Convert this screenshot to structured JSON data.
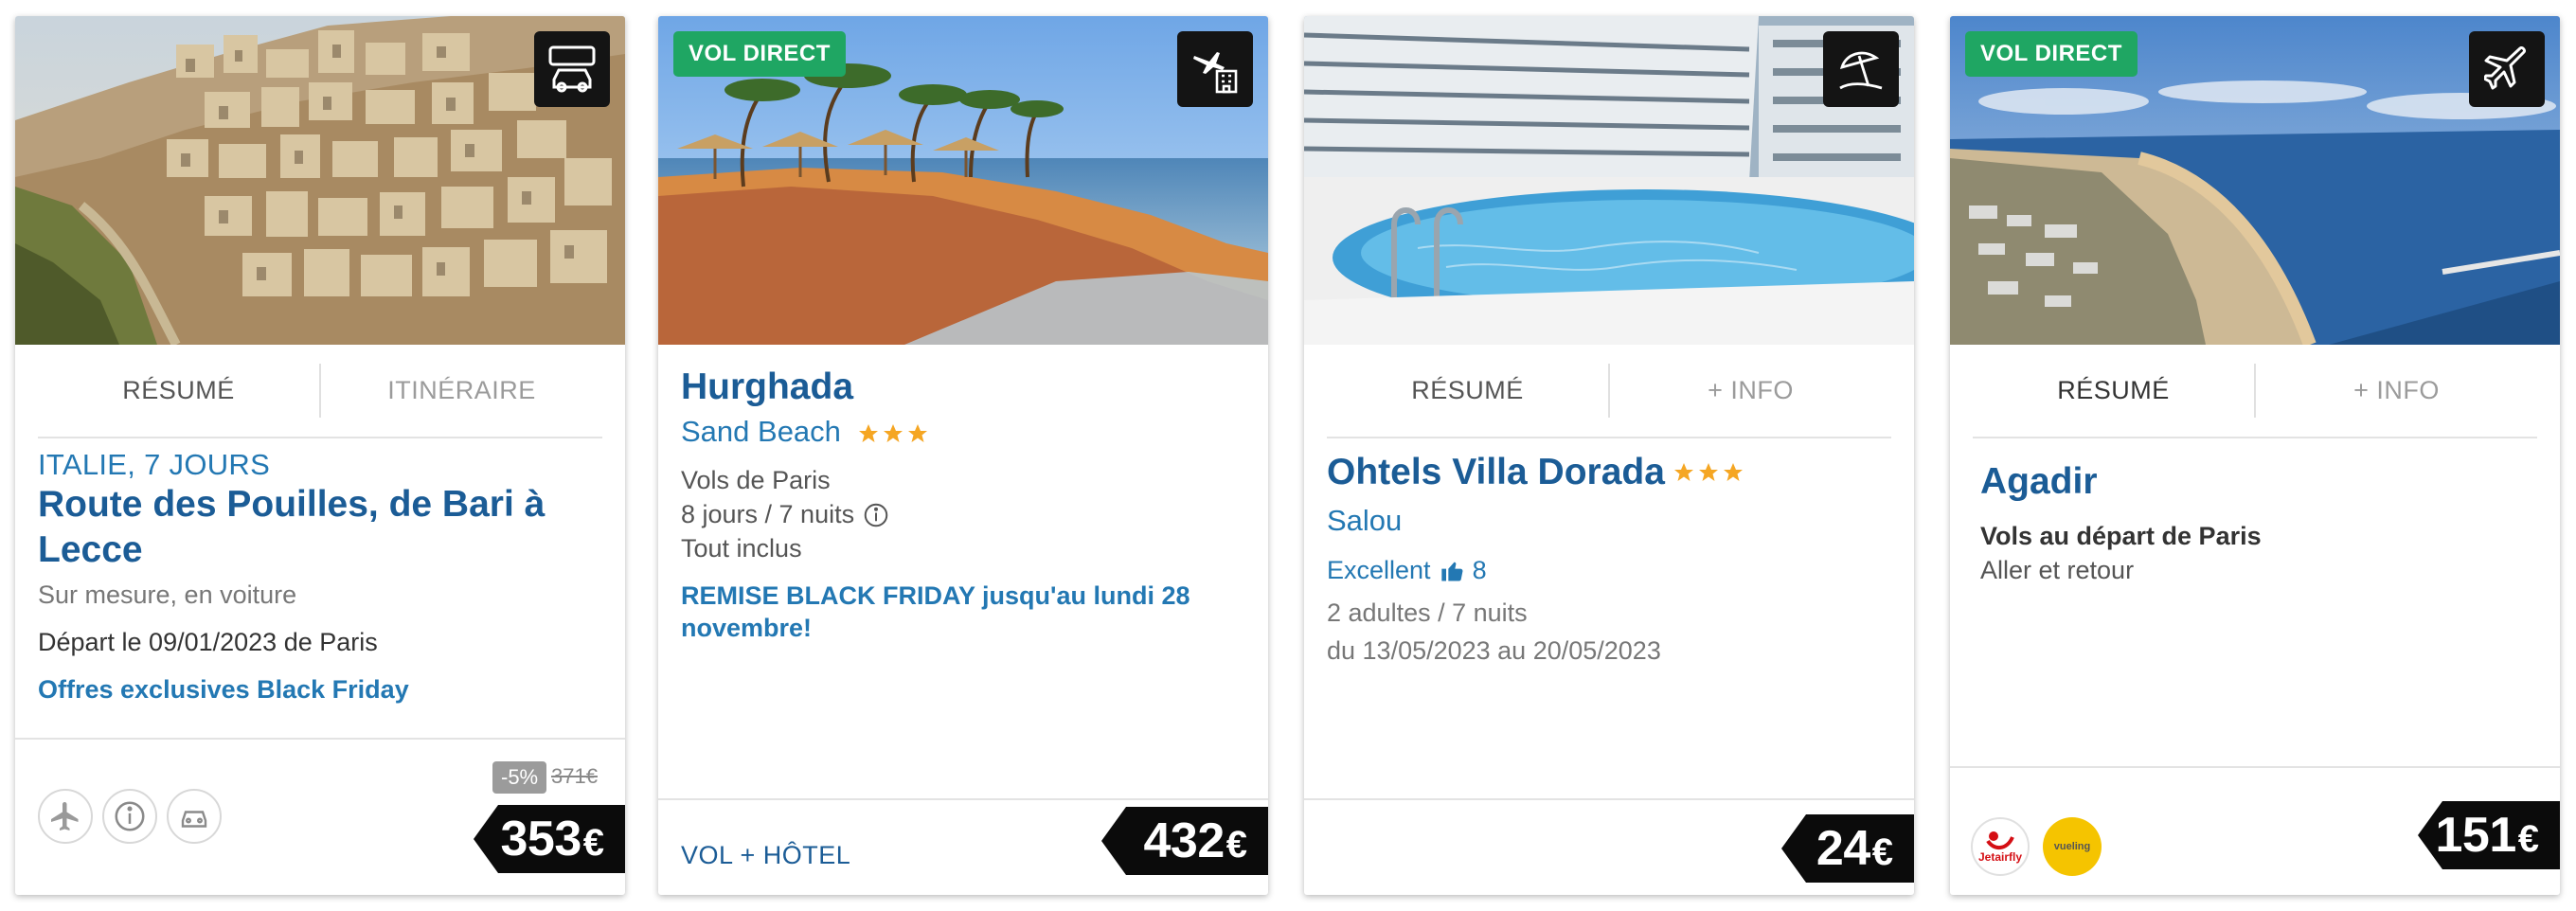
{
  "cards": [
    {
      "type_icon": "car-icon",
      "tabs": [
        "RÉSUMÉ",
        "ITINÉRAIRE"
      ],
      "subtitle": "ITALIE, 7 JOURS",
      "title": "Route des Pouilles, de Bari à Lecce",
      "meta": "Sur mesure, en voiture",
      "departure": "Départ le 09/01/2023 de Paris",
      "promo": "Offres exclusives Black Friday",
      "footer_icons": [
        "plane-icon",
        "info-icon",
        "car-icon"
      ],
      "discount": "-5%",
      "old_price": "371€",
      "price": "353",
      "currency": "€"
    },
    {
      "badge": "VOL DIRECT",
      "type_icon": "plane-hotel-icon",
      "title": "Hurghada",
      "hotel": "Sand Beach",
      "stars": 3,
      "line1": "Vols de Paris",
      "line2": "8 jours / 7 nuits",
      "line3": "Tout inclus",
      "promo": "REMISE BLACK FRIDAY jusqu'au lundi 28 novembre!",
      "footer_label": "VOL + HÔTEL",
      "price": "432",
      "currency": "€"
    },
    {
      "type_icon": "beach-umbrella-icon",
      "tabs": [
        "RÉSUMÉ",
        "+ INFO"
      ],
      "title": "Ohtels Villa Dorada",
      "stars": 3,
      "location": "Salou",
      "rating_label": "Excellent",
      "rating_value": "8",
      "guests": "2 adultes / 7 nuits",
      "dates": "du 13/05/2023 au 20/05/2023",
      "price": "24",
      "currency": "€"
    },
    {
      "badge": "VOL DIRECT",
      "type_icon": "plane-icon",
      "tabs": [
        "RÉSUMÉ",
        "+ INFO"
      ],
      "title": "Agadir",
      "line1": "Vols au départ de Paris",
      "line2": "Aller et retour",
      "airline_logos": [
        {
          "name": "tui-fly-logo",
          "text": "Jetairfly"
        },
        {
          "name": "vueling-logo",
          "text": "vueling"
        }
      ],
      "price": "151",
      "currency": "€"
    }
  ],
  "colors": {
    "accent_blue": "#2378b3",
    "title_navy": "#1b5c96",
    "badge_green": "#1fa663",
    "star_gold": "#f5a623",
    "price_bg": "#0b0b0b"
  }
}
